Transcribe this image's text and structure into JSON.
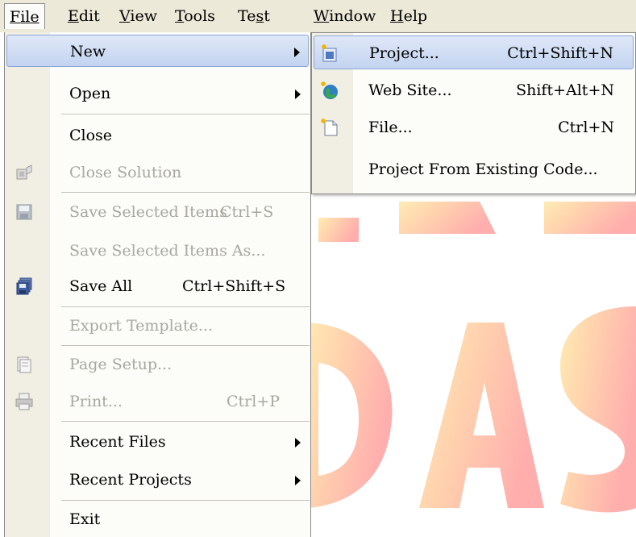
{
  "menubar": {
    "items": [
      {
        "label": "File",
        "underline_index": 0
      },
      {
        "label": "Edit",
        "underline_index": 0
      },
      {
        "label": "View",
        "underline_index": 0
      },
      {
        "label": "Tools",
        "underline_index": 0
      },
      {
        "label": "Test",
        "underline_index": 2
      },
      {
        "label": "Window",
        "underline_index": 0
      },
      {
        "label": "Help",
        "underline_index": 0
      }
    ]
  },
  "file_menu": {
    "items": [
      {
        "label": "New",
        "shortcut": "",
        "icon": "",
        "disabled": false,
        "highlighted": true,
        "submenu": true
      },
      {
        "label": "Open",
        "shortcut": "",
        "icon": "",
        "disabled": false,
        "submenu": true
      },
      {
        "label": "Close",
        "shortcut": "",
        "icon": "",
        "disabled": false
      },
      {
        "label": "Close Solution",
        "shortcut": "",
        "icon": "close-solution-icon",
        "disabled": true
      },
      {
        "label": "Save Selected Items",
        "shortcut": "Ctrl+S",
        "icon": "floppy-disk-icon",
        "disabled": true
      },
      {
        "label": "Save Selected Items As...",
        "shortcut": "",
        "icon": "",
        "disabled": true
      },
      {
        "label": "Save All",
        "shortcut": "Ctrl+Shift+S",
        "icon": "save-all-icon",
        "disabled": false
      },
      {
        "label": "Export Template...",
        "shortcut": "",
        "icon": "",
        "disabled": true
      },
      {
        "label": "Page Setup...",
        "shortcut": "",
        "icon": "page-setup-icon",
        "disabled": true
      },
      {
        "label": "Print...",
        "shortcut": "Ctrl+P",
        "icon": "printer-icon",
        "disabled": true
      },
      {
        "label": "Recent Files",
        "shortcut": "",
        "icon": "",
        "disabled": false,
        "submenu": true
      },
      {
        "label": "Recent Projects",
        "shortcut": "",
        "icon": "",
        "disabled": false,
        "submenu": true
      },
      {
        "label": "Exit",
        "shortcut": "",
        "icon": "",
        "disabled": false
      }
    ]
  },
  "new_submenu": {
    "items": [
      {
        "label": "Project...",
        "shortcut": "Ctrl+Shift+N",
        "icon": "new-project-icon",
        "highlighted": true
      },
      {
        "label": "Web Site...",
        "shortcut": "Shift+Alt+N",
        "icon": "globe-icon"
      },
      {
        "label": "File...",
        "shortcut": "Ctrl+N",
        "icon": "new-file-icon"
      },
      {
        "label": "Project From Existing Code...",
        "shortcut": "",
        "icon": ""
      }
    ]
  },
  "watermark": {
    "text": "DAS"
  }
}
